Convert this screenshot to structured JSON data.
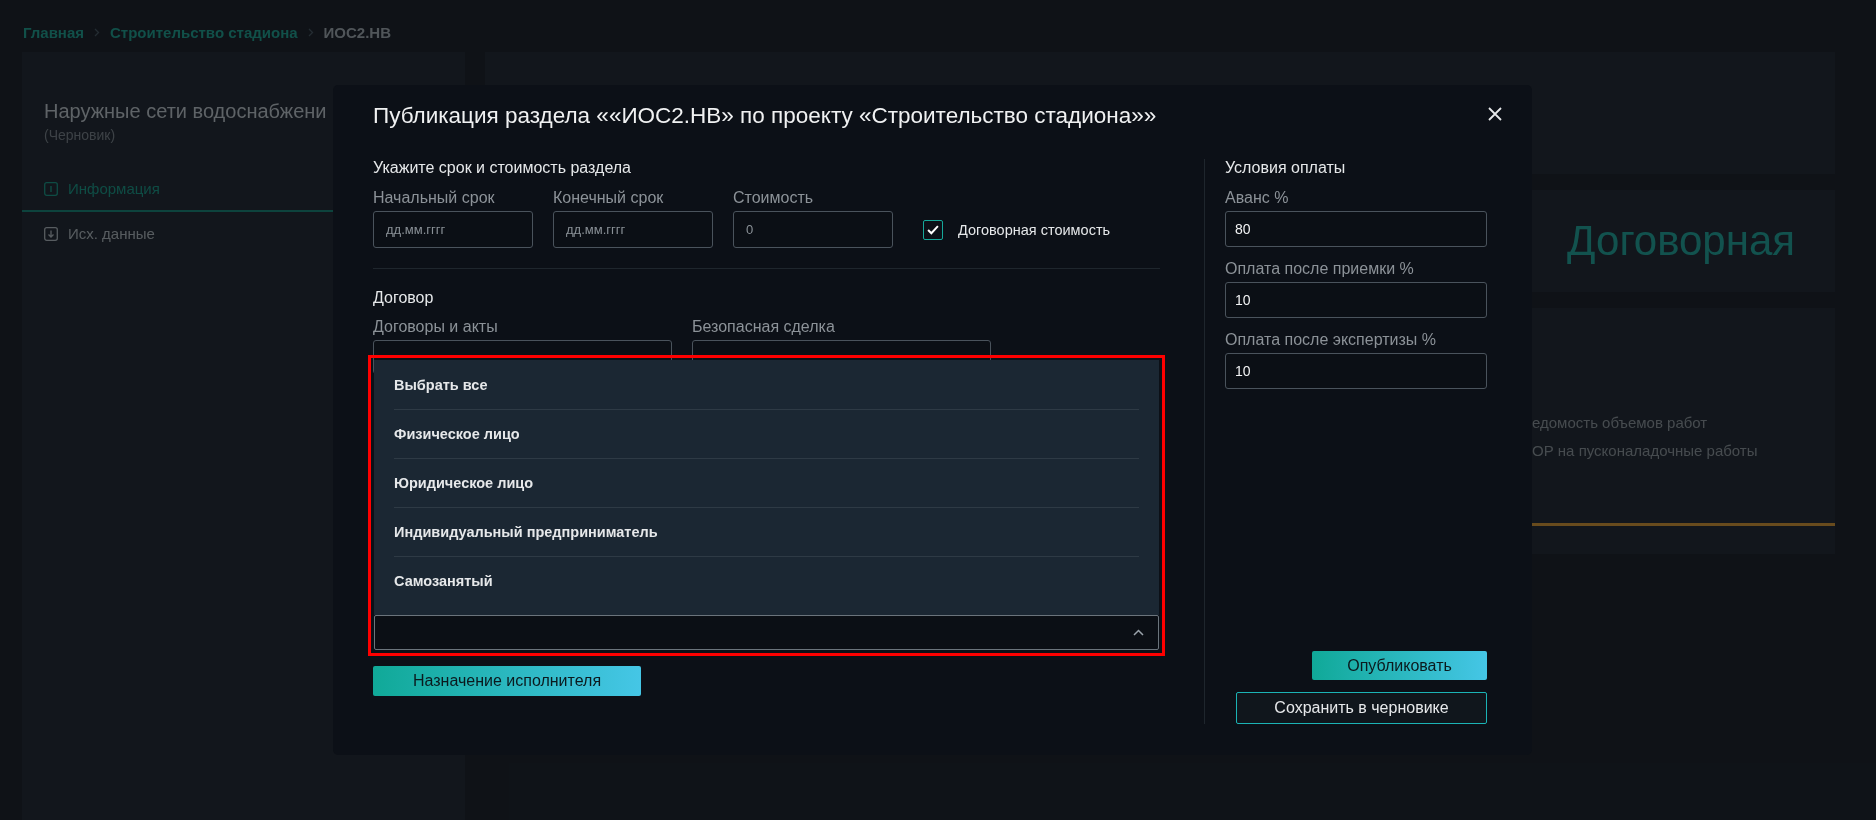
{
  "breadcrumb": [
    {
      "label": "Главная",
      "selected": false
    },
    {
      "label": "Строительство стадиона",
      "selected": false
    },
    {
      "label": "ИОС2.НВ",
      "selected": true
    }
  ],
  "sidebar": {
    "title": "Наружные сети водоснабжени",
    "status": "(Черновик)",
    "tabs": [
      {
        "label": "Информация",
        "selected": true,
        "kind": "info"
      },
      {
        "label": "Исх. данные",
        "selected": false,
        "kind": "download"
      }
    ]
  },
  "background": {
    "price": "Договорная",
    "documents": [
      "едомость объемов работ",
      "ОР на пусконаладочные работы"
    ]
  },
  "modal": {
    "title": "Публикация раздела ««ИОС2.НВ» по проекту «Строительство стадиона»»",
    "dates_section": {
      "title": "Укажите срок и стоимость раздела",
      "fields": [
        {
          "label": "Начальный срок",
          "placeholder": "дд.мм.гггг"
        },
        {
          "label": "Конечный срок",
          "placeholder": "дд.мм.гггг"
        },
        {
          "label": "Стоимость",
          "placeholder": "0"
        }
      ],
      "negotiable": {
        "label": "Договорная стоимость",
        "checked": true
      }
    },
    "contract_section": {
      "title": "Договор",
      "fields": [
        {
          "label": "Договоры и акты"
        },
        {
          "label": "Безопасная сделка"
        }
      ],
      "dropdown": {
        "expanded": true,
        "highlighted": true,
        "options": [
          "Выбрать все",
          "Физическое лицо",
          "Юридическое лицо",
          "Индивидуальный предприниматель",
          "Самозанятый"
        ]
      }
    },
    "assign_button": "Назначение исполнителя",
    "payment": {
      "title": "Условия оплаты",
      "fields": [
        {
          "label": "Аванс %",
          "value": "80"
        },
        {
          "label": "Оплата после приемки %",
          "value": "10"
        },
        {
          "label": "Оплата после экспертизы %",
          "value": "10"
        }
      ]
    },
    "buttons": [
      {
        "label": "Опубликовать",
        "kind": "primary"
      },
      {
        "label": "Сохранить в черновике",
        "kind": "secondary"
      }
    ]
  }
}
